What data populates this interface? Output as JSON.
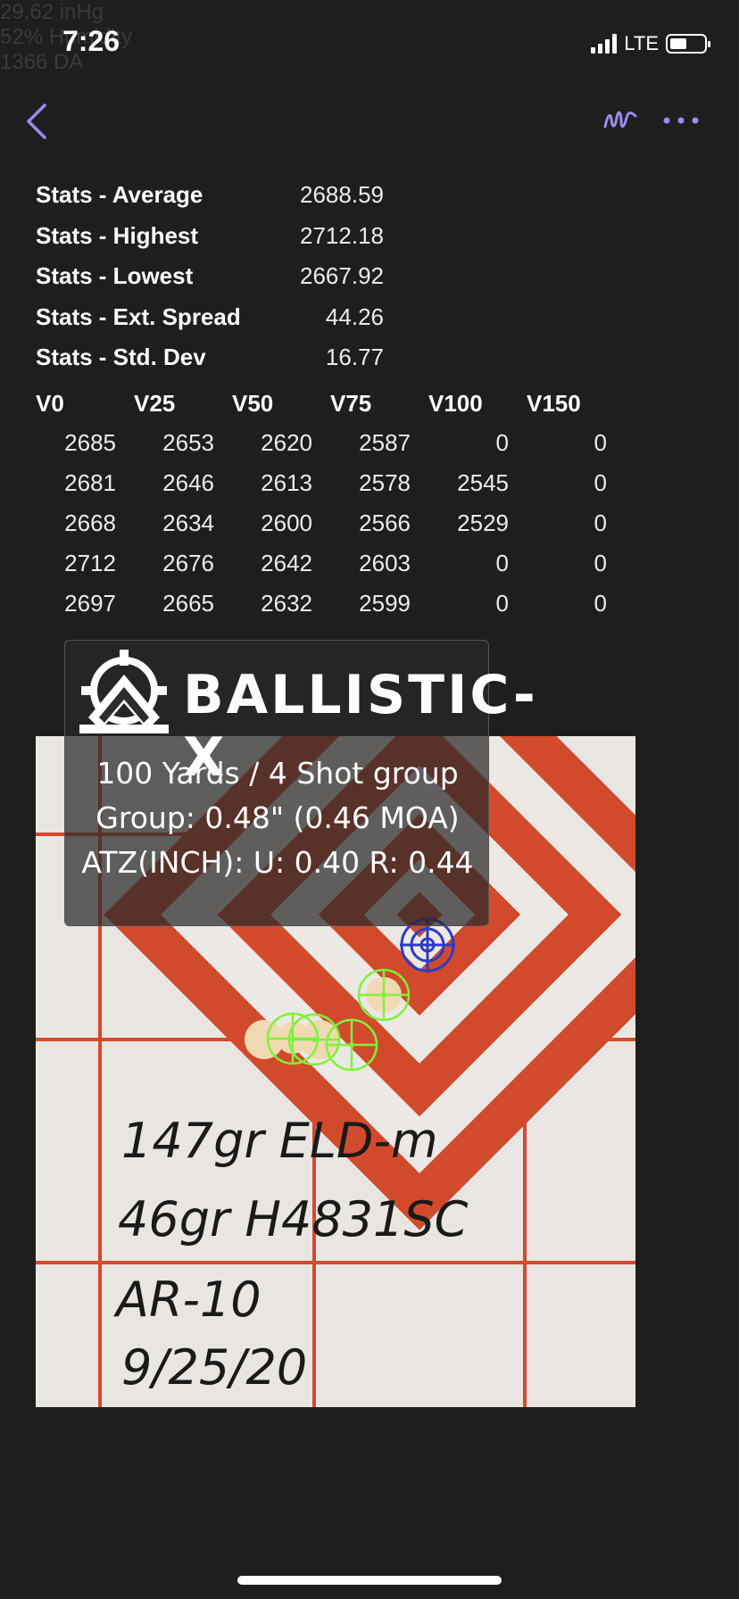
{
  "status_bar": {
    "time": "7:26",
    "network": "LTE"
  },
  "background_ghost": [
    "29.62 inHg",
    "52% Humidity",
    "1366 DA"
  ],
  "stats": [
    {
      "label": "Stats - Average",
      "value": "2688.59"
    },
    {
      "label": "Stats - Highest",
      "value": "2712.18"
    },
    {
      "label": "Stats - Lowest",
      "value": "2667.92"
    },
    {
      "label": "Stats - Ext. Spread",
      "value": "44.26"
    },
    {
      "label": "Stats - Std. Dev",
      "value": "16.77"
    }
  ],
  "velocity_table": {
    "headers": [
      "V0",
      "V25",
      "V50",
      "V75",
      "V100",
      "V150"
    ],
    "rows": [
      [
        "2685",
        "2653",
        "2620",
        "2587",
        "0",
        "0"
      ],
      [
        "2681",
        "2646",
        "2613",
        "2578",
        "2545",
        "0"
      ],
      [
        "2668",
        "2634",
        "2600",
        "2566",
        "2529",
        "0"
      ],
      [
        "2712",
        "2676",
        "2642",
        "2603",
        "0",
        "0"
      ],
      [
        "2697",
        "2665",
        "2632",
        "2599",
        "0",
        "0"
      ]
    ]
  },
  "banner": {
    "brand": "BALLISTIC-X",
    "line1": "100 Yards / 4 Shot group",
    "line2": "Group: 0.48\" (0.46 MOA)",
    "line3": "ATZ(INCH): U: 0.40 R: 0.44"
  },
  "target_notes": {
    "line1": "147gr ELD-m",
    "line2": "46gr H4831SC",
    "line3": "AR-10",
    "line4": "9/25/20"
  },
  "icons": {
    "back": "chevron-left-icon",
    "signature": "squiggle-icon",
    "more": "more-horizontal-icon"
  },
  "colors": {
    "accent": "#9b8cf0",
    "target_red": "#d24a2c",
    "shot_marker": "#7ef23a",
    "aim_point": "#2a3cc8"
  }
}
